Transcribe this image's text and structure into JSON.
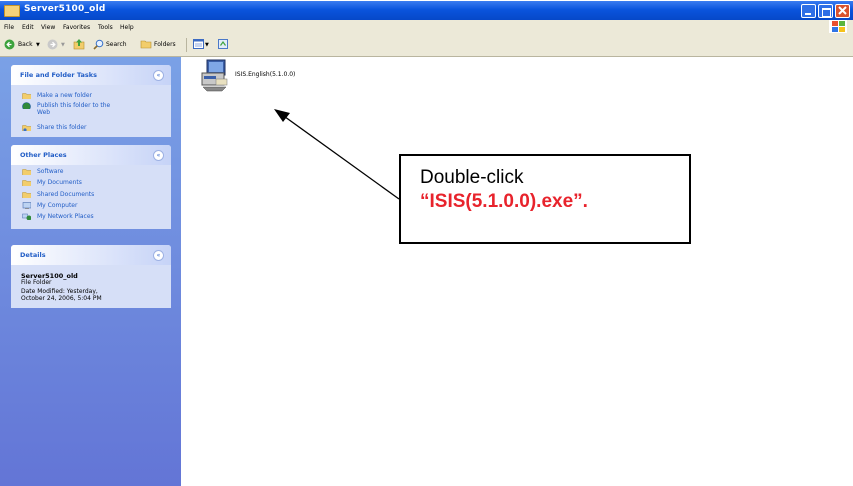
{
  "window": {
    "title": "Server5100_old"
  },
  "menu": [
    "File",
    "Edit",
    "View",
    "Favorites",
    "Tools",
    "Help"
  ],
  "toolbar": {
    "back": "Back",
    "search": "Search",
    "folders": "Folders"
  },
  "left_pane": {
    "tasks": {
      "title": "File and Folder Tasks",
      "items": [
        {
          "label": "Make a new folder",
          "icon": "new-folder-icon"
        },
        {
          "label": "Publish this folder to the",
          "label2": "Web",
          "icon": "globe-icon"
        },
        {
          "label": "Share this folder",
          "icon": "share-icon"
        }
      ]
    },
    "other_places": {
      "title": "Other Places",
      "items": [
        {
          "label": "Software",
          "icon": "folder-icon"
        },
        {
          "label": "My Documents",
          "icon": "folder-icon"
        },
        {
          "label": "Shared Documents",
          "icon": "folder-icon"
        },
        {
          "label": "My Computer",
          "icon": "computer-icon"
        },
        {
          "label": "My Network Places",
          "icon": "network-icon"
        }
      ]
    },
    "details": {
      "title": "Details",
      "name": "Server5100_old",
      "type": "File Folder",
      "modified_line1": "Date Modified: Yesterday,",
      "modified_line2": "October 24, 2006, 5:04 PM"
    }
  },
  "main": {
    "file_label": "ISIS.English(5.1.0.0)"
  },
  "callout": {
    "line1": "Double-click",
    "line2": "“ISIS(5.1.0.0).exe”."
  },
  "colors": {
    "titlebar": "#0a54dd",
    "pane": "#7aa1e6",
    "link": "#215dc6",
    "callout_red": "#e8232c"
  }
}
